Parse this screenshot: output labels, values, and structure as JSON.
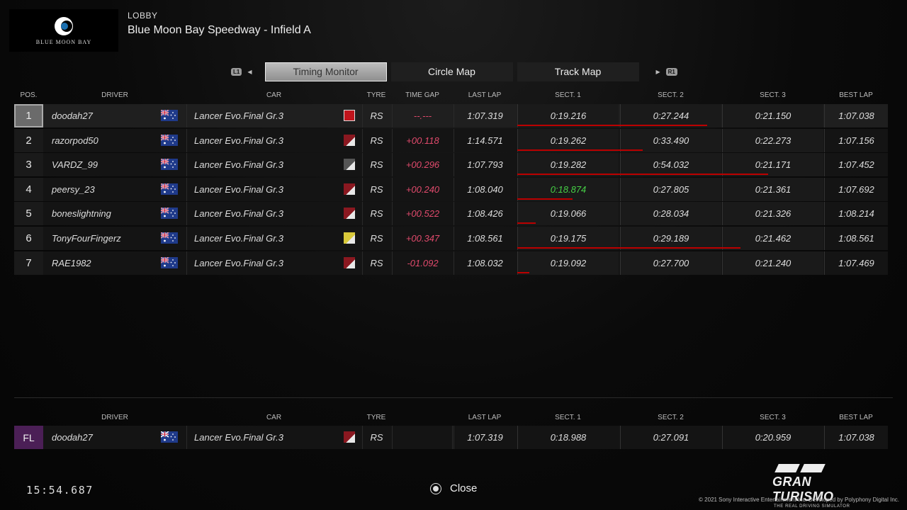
{
  "header": {
    "logo_text": "BLUE MOON BAY",
    "lobby_label": "LOBBY",
    "track_title": "Blue Moon Bay Speedway - Infield A"
  },
  "tabs": {
    "left_hint": "L1",
    "right_hint": "R1",
    "items": [
      {
        "label": "Timing Monitor",
        "active": true
      },
      {
        "label": "Circle Map",
        "active": false
      },
      {
        "label": "Track Map",
        "active": false
      }
    ]
  },
  "results": {
    "headers": {
      "pos": "POS.",
      "driver": "DRIVER",
      "car": "CAR",
      "tyre": "TYRE",
      "gap": "TIME GAP",
      "last": "LAST LAP",
      "s1": "SECT. 1",
      "s2": "SECT. 2",
      "s3": "SECT. 3",
      "best": "BEST LAP"
    },
    "rows": [
      {
        "pos": "1",
        "driver": "doodah27",
        "car": "Lancer Evo.Final Gr.3",
        "tyre": "RS",
        "gap": "--.---",
        "last": "1:07.319",
        "s1": "0:19.216",
        "s2": "0:27.244",
        "s3": "0:21.150",
        "best": "1:07.038",
        "swatch_color": "#c0141c",
        "swatch_style": "solid",
        "progress": 0.62
      },
      {
        "pos": "2",
        "driver": "razorpod50",
        "car": "Lancer Evo.Final Gr.3",
        "tyre": "RS",
        "gap": "+00.118",
        "last": "1:14.571",
        "s1": "0:19.262",
        "s2": "0:33.490",
        "s3": "0:22.273",
        "best": "1:07.156",
        "swatch_color": "#8a1820",
        "swatch_style": "split",
        "progress": 0.41
      },
      {
        "pos": "3",
        "driver": "VARDZ_99",
        "car": "Lancer Evo.Final Gr.3",
        "tyre": "RS",
        "gap": "+00.296",
        "last": "1:07.793",
        "s1": "0:19.282",
        "s2": "0:54.032",
        "s3": "0:21.171",
        "best": "1:07.452",
        "swatch_color": "#555555",
        "swatch_style": "split",
        "progress": 0.82
      },
      {
        "pos": "4",
        "driver": "peersy_23",
        "car": "Lancer Evo.Final Gr.3",
        "tyre": "RS",
        "gap": "+00.240",
        "last": "1:08.040",
        "s1": "0:18.874",
        "s2": "0:27.805",
        "s3": "0:21.361",
        "best": "1:07.692",
        "swatch_color": "#8a1820",
        "swatch_style": "split",
        "progress": 0.18,
        "s1_best": true
      },
      {
        "pos": "5",
        "driver": "boneslightning",
        "car": "Lancer Evo.Final Gr.3",
        "tyre": "RS",
        "gap": "+00.522",
        "last": "1:08.426",
        "s1": "0:19.066",
        "s2": "0:28.034",
        "s3": "0:21.326",
        "best": "1:08.214",
        "swatch_color": "#8a1820",
        "swatch_style": "split",
        "progress": 0.06
      },
      {
        "pos": "6",
        "driver": "TonyFourFingerz",
        "car": "Lancer Evo.Final Gr.3",
        "tyre": "RS",
        "gap": "+00.347",
        "last": "1:08.561",
        "s1": "0:19.175",
        "s2": "0:29.189",
        "s3": "0:21.462",
        "best": "1:08.561",
        "swatch_color": "#d9c93a",
        "swatch_style": "split",
        "progress": 0.73
      },
      {
        "pos": "7",
        "driver": "RAE1982",
        "car": "Lancer Evo.Final Gr.3",
        "tyre": "RS",
        "gap": "-01.092",
        "last": "1:08.032",
        "s1": "0:19.092",
        "s2": "0:27.700",
        "s3": "0:21.240",
        "best": "1:07.469",
        "swatch_color": "#8a1820",
        "swatch_style": "split",
        "progress": 0.04
      }
    ]
  },
  "fastest": {
    "headers": {
      "driver": "DRIVER",
      "car": "CAR",
      "tyre": "TYRE",
      "last": "LAST LAP",
      "s1": "SECT. 1",
      "s2": "SECT. 2",
      "s3": "SECT. 3",
      "best": "BEST LAP"
    },
    "row": {
      "pos": "FL",
      "driver": "doodah27",
      "car": "Lancer Evo.Final Gr.3",
      "tyre": "RS",
      "last": "1:07.319",
      "s1": "0:18.988",
      "s2": "0:27.091",
      "s3": "0:20.959",
      "best": "1:07.038",
      "swatch_color": "#8a1820"
    }
  },
  "footer": {
    "clock": "15:54.687",
    "close_label": "Close",
    "brand": "GRAN TURISMO",
    "brand_sub": "THE REAL DRIVING SIMULATOR",
    "copyright": "© 2021 Sony Interactive Entertainment Inc. Developed by Polyphony Digital Inc."
  }
}
